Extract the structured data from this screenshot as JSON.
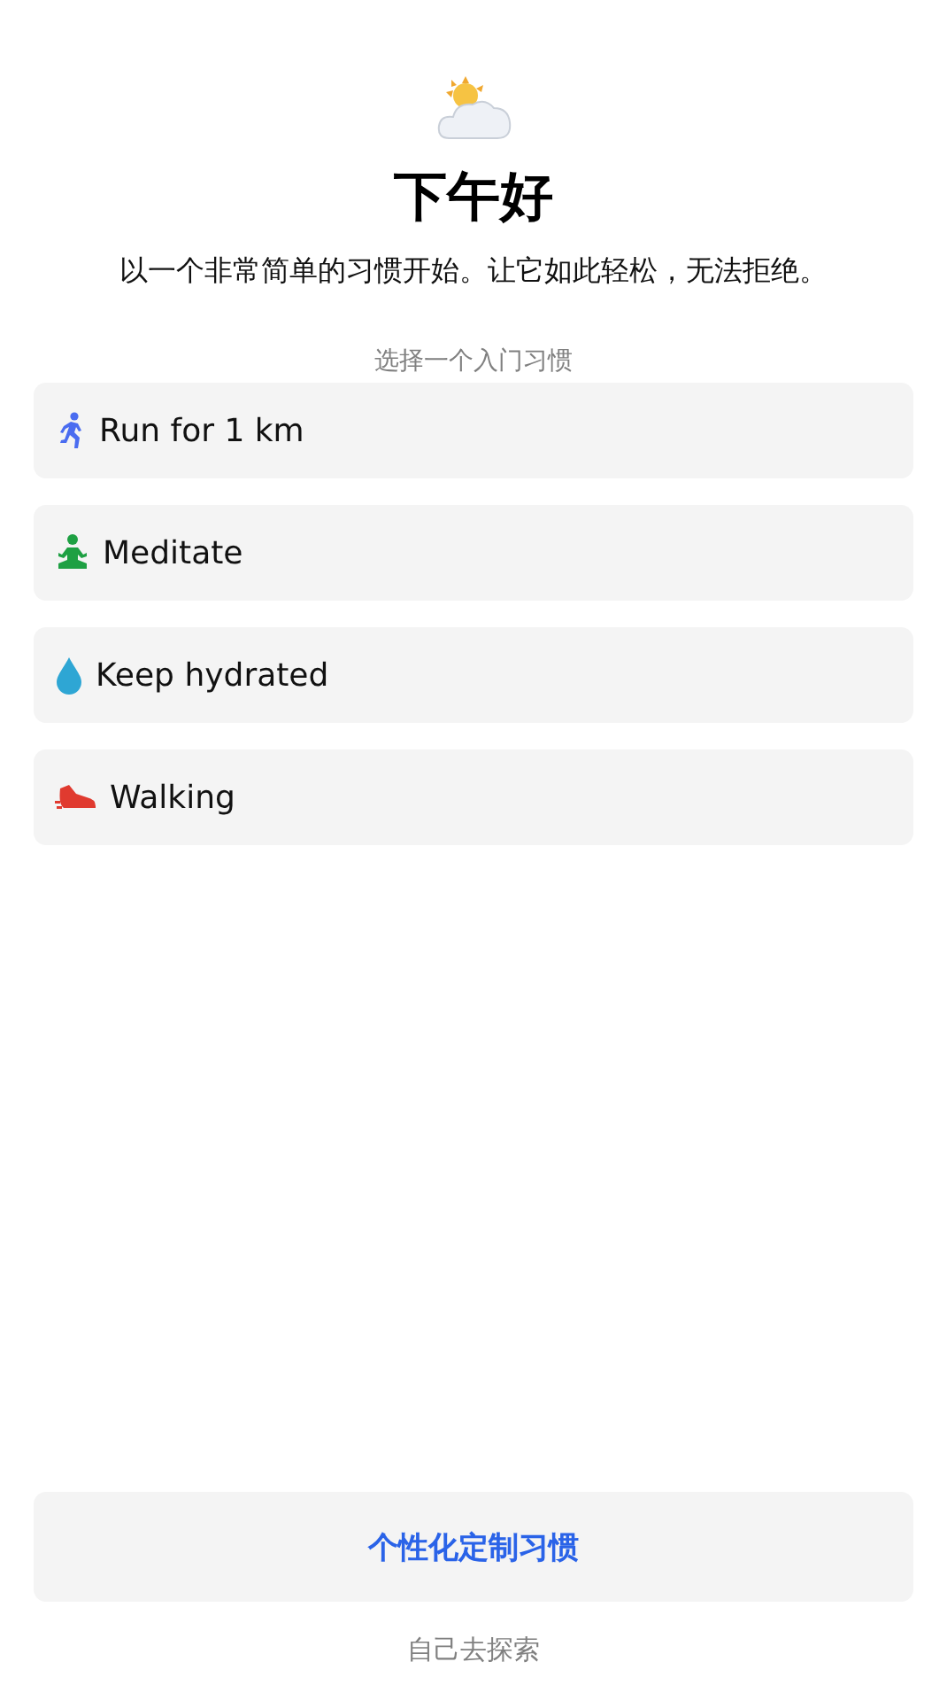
{
  "greeting": "下午好",
  "subtitle": "以一个非常简单的习惯开始。让它如此轻松，无法拒绝。",
  "section_label": "选择一个入门习惯",
  "habits": [
    {
      "kind": "run",
      "label": "Run for 1 km"
    },
    {
      "kind": "meditate",
      "label": "Meditate"
    },
    {
      "kind": "water",
      "label": "Keep hydrated"
    },
    {
      "kind": "walk",
      "label": "Walking"
    }
  ],
  "primary_button": "个性化定制习惯",
  "secondary_link": "自己去探索"
}
